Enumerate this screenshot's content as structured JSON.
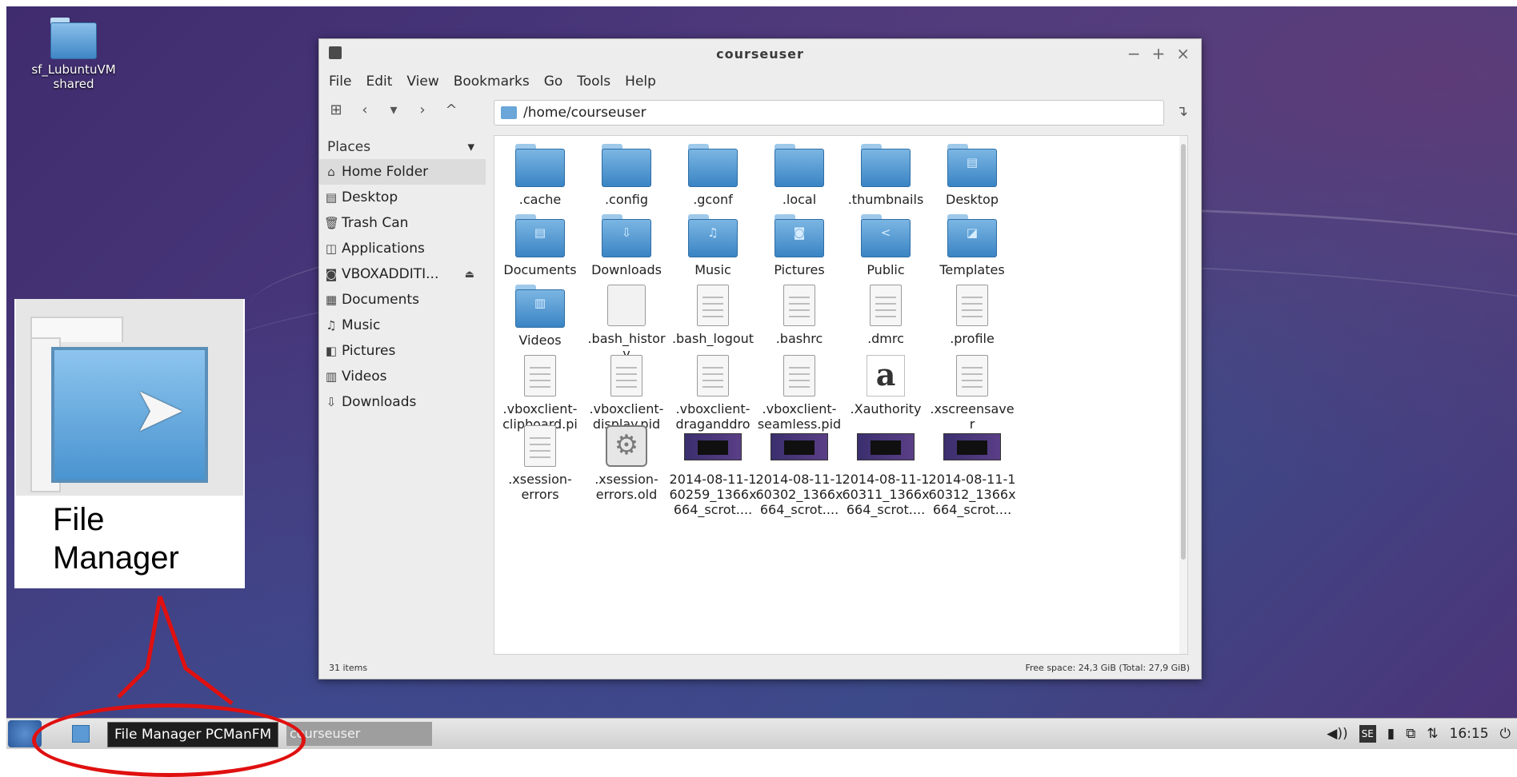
{
  "desktop": {
    "icon": {
      "label_line1": "sf_LubuntuVM",
      "label_line2": "shared",
      "icon": "folder-icon"
    }
  },
  "window": {
    "title": "courseuser",
    "controls": [
      "−",
      "+",
      "×"
    ],
    "menu": [
      "File",
      "Edit",
      "View",
      "Bookmarks",
      "Go",
      "Tools",
      "Help"
    ],
    "path": "/home/courseuser",
    "sidebar": {
      "header": "Places",
      "header_arrow": "▾",
      "items": [
        {
          "label": "Home Folder",
          "icon": "⌂",
          "selected": true
        },
        {
          "label": "Desktop",
          "icon": "▤"
        },
        {
          "label": "Trash Can",
          "icon": "🗑"
        },
        {
          "label": "Applications",
          "icon": "◫"
        },
        {
          "label": "VBOXADDITI...",
          "icon": "◙",
          "eject": "⏏"
        },
        {
          "label": "Documents",
          "icon": "▦"
        },
        {
          "label": "Music",
          "icon": "♫"
        },
        {
          "label": "Pictures",
          "icon": "◧"
        },
        {
          "label": "Videos",
          "icon": "▥"
        },
        {
          "label": "Downloads",
          "icon": "⇩"
        }
      ]
    },
    "files": [
      {
        "name": ".cache",
        "type": "folder"
      },
      {
        "name": ".config",
        "type": "folder"
      },
      {
        "name": ".gconf",
        "type": "folder"
      },
      {
        "name": ".local",
        "type": "folder"
      },
      {
        "name": ".thumbnails",
        "type": "folder"
      },
      {
        "name": "Desktop",
        "type": "folder",
        "glyph": "▤"
      },
      {
        "name": "Documents",
        "type": "folder",
        "glyph": "▤"
      },
      {
        "name": "Downloads",
        "type": "folder",
        "glyph": "⇩"
      },
      {
        "name": "Music",
        "type": "folder",
        "glyph": "♫"
      },
      {
        "name": "Pictures",
        "type": "folder",
        "glyph": "◙"
      },
      {
        "name": "Public",
        "type": "folder",
        "glyph": "<"
      },
      {
        "name": "Templates",
        "type": "folder",
        "glyph": "◪"
      },
      {
        "name": "Videos",
        "type": "folder",
        "glyph": "▥"
      },
      {
        "name": ".bash_histor\ny",
        "type": "blank"
      },
      {
        "name": ".bash_logout",
        "type": "doc"
      },
      {
        "name": ".bashrc",
        "type": "doc"
      },
      {
        "name": ".dmrc",
        "type": "doc"
      },
      {
        "name": ".profile",
        "type": "doc"
      },
      {
        "name": ".vboxclient-\nclipboard.pi\nd",
        "type": "doc"
      },
      {
        "name": ".vboxclient-\ndisplay.pid",
        "type": "doc"
      },
      {
        "name": ".vboxclient-\ndraganddro\np.pid",
        "type": "doc"
      },
      {
        "name": ".vboxclient-\nseamless.pid",
        "type": "doc"
      },
      {
        "name": ".Xauthority",
        "type": "font",
        "glyph": "a"
      },
      {
        "name": ".xscreensave\nr",
        "type": "doc"
      },
      {
        "name": ".xsession-\nerrors",
        "type": "doc"
      },
      {
        "name": ".xsession-\nerrors.old",
        "type": "gear",
        "glyph": "⚙"
      },
      {
        "name": "2014-08-11-1\n60259_1366x\n664_scrot....",
        "type": "image"
      },
      {
        "name": "2014-08-11-1\n60302_1366x\n664_scrot....",
        "type": "image"
      },
      {
        "name": "2014-08-11-1\n60311_1366x\n664_scrot....",
        "type": "image"
      },
      {
        "name": "2014-08-11-1\n60312_1366x\n664_scrot....",
        "type": "image"
      }
    ],
    "status": {
      "items": "31 items",
      "free_space": "Free space: 24,3 GiB (Total: 27,9 GiB)"
    }
  },
  "callout": {
    "label_line1": "File",
    "label_line2": "Manager",
    "accent": "#e01010"
  },
  "taskbar": {
    "tooltip": "File Manager PCManFM",
    "task_label": "courseuser",
    "tray": {
      "volume": "◀))",
      "keyboard": "SE",
      "clock": "16:15",
      "power": "⏻"
    }
  }
}
